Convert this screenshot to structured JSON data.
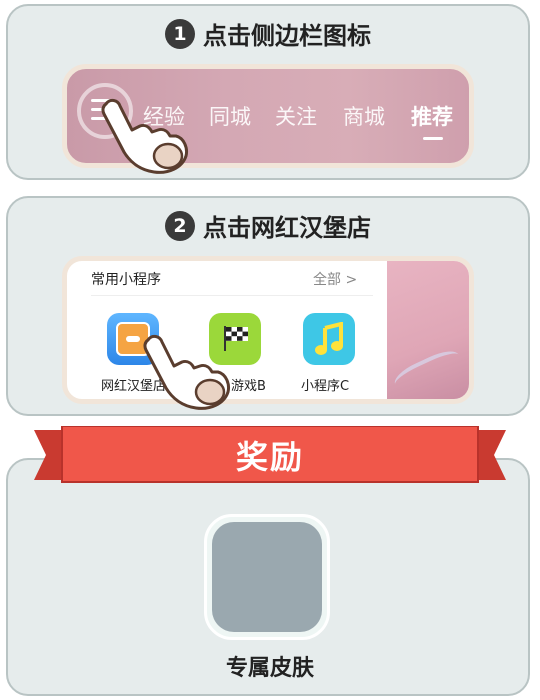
{
  "step1": {
    "number": "1",
    "title": "点击侧边栏图标",
    "nav_tabs": [
      "经验",
      "同城",
      "关注",
      "商城",
      "推荐"
    ],
    "active_tab": "推荐"
  },
  "step2": {
    "number": "2",
    "title": "点击网红汉堡店",
    "section_header": "常用小程序",
    "see_all": "全部 >",
    "apps": [
      {
        "label": "网红汉堡店",
        "icon": "burger-shop-icon"
      },
      {
        "label": "游戏B",
        "icon": "checkered-flag-icon"
      },
      {
        "label": "小程序C",
        "icon": "music-note-icon"
      }
    ]
  },
  "reward": {
    "ribbon_title": "奖励",
    "item_label": "专属皮肤"
  },
  "colors": {
    "panel_bg": "#e6ecec",
    "ribbon_red": "#f0574a",
    "ribbon_dark": "#b8322b"
  }
}
